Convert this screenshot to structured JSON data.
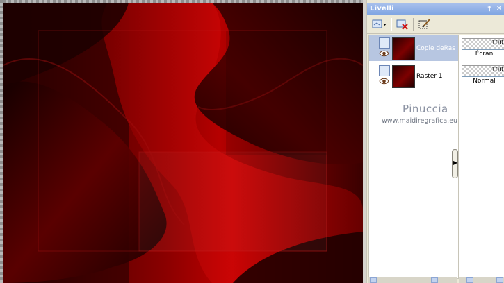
{
  "panel": {
    "title": "Livelli",
    "pin_icon": "pin-icon",
    "close_icon": "close-icon"
  },
  "toolbar": {
    "new_layer_icon": "new-layer-icon",
    "delete_layer_icon": "delete-layer-icon",
    "edit_selection_icon": "edit-selection-icon"
  },
  "layers": [
    {
      "name": "Copie deRas",
      "opacity": "100",
      "blend_mode": "Écran",
      "visible_icon": "eye-icon",
      "selected": true
    },
    {
      "name": "Raster 1",
      "opacity": "100",
      "blend_mode": "Normal",
      "visible_icon": "eye-icon",
      "selected": false
    }
  ],
  "watermark": {
    "name": "Pinuccia",
    "url": "www.maidiregrafica.eu"
  },
  "colors": {
    "titlebar": "#7ea4e2",
    "selected_row": "#b7c6e1",
    "canvas_dark": "#2a0000",
    "canvas_red": "#b00000"
  }
}
